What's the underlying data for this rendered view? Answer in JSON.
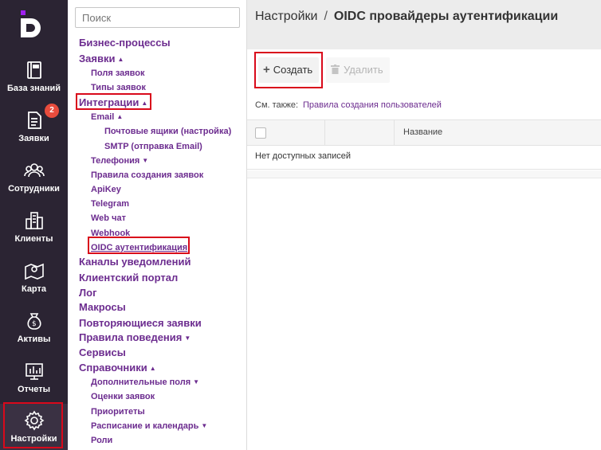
{
  "rail": {
    "items": [
      {
        "label": "База знаний",
        "icon": "book-icon"
      },
      {
        "label": "Заявки",
        "icon": "document-icon",
        "badge": "2"
      },
      {
        "label": "Сотрудники",
        "icon": "people-icon"
      },
      {
        "label": "Клиенты",
        "icon": "building-icon"
      },
      {
        "label": "Карта",
        "icon": "map-icon"
      },
      {
        "label": "Активы",
        "icon": "money-bag-icon"
      },
      {
        "label": "Отчеты",
        "icon": "chart-icon"
      },
      {
        "label": "Настройки",
        "icon": "gear-icon"
      }
    ],
    "active": "Настройки"
  },
  "tree": {
    "search_placeholder": "Поиск",
    "items": [
      "Бизнес-процессы",
      "Заявки",
      "Поля заявок",
      "Типы заявок",
      "Интеграции",
      "Email",
      "Почтовые ящики (настройка)",
      "SMTP (отправка Email)",
      "Телефония",
      "Правила создания заявок",
      "ApiKey",
      "Telegram",
      "Web чат",
      "Webhook",
      "OIDC аутентификация",
      "Каналы уведомлений",
      "Клиентский портал",
      "Лог",
      "Макросы",
      "Повторяющиеся заявки",
      "Правила поведения",
      "Сервисы",
      "Справочники",
      "Дополнительные поля",
      "Оценки заявок",
      "Приоритеты",
      "Расписание и календарь",
      "Роли"
    ],
    "caret_up": "▲",
    "caret_down": "▼"
  },
  "main": {
    "breadcrumb_root": "Настройки",
    "breadcrumb_sep": "/",
    "breadcrumb_current": "OIDC провайдеры аутентификации",
    "create_label": "Создать",
    "delete_label": "Удалить",
    "see_also_label": "См. также:",
    "see_also_link": "Правила создания пользователей",
    "col_name": "Название",
    "empty_text": "Нет доступных записей"
  },
  "colors": {
    "rail_bg": "#2b2433",
    "link": "#6c2c8f",
    "highlight": "#d9091b",
    "badge": "#e84c3d"
  }
}
